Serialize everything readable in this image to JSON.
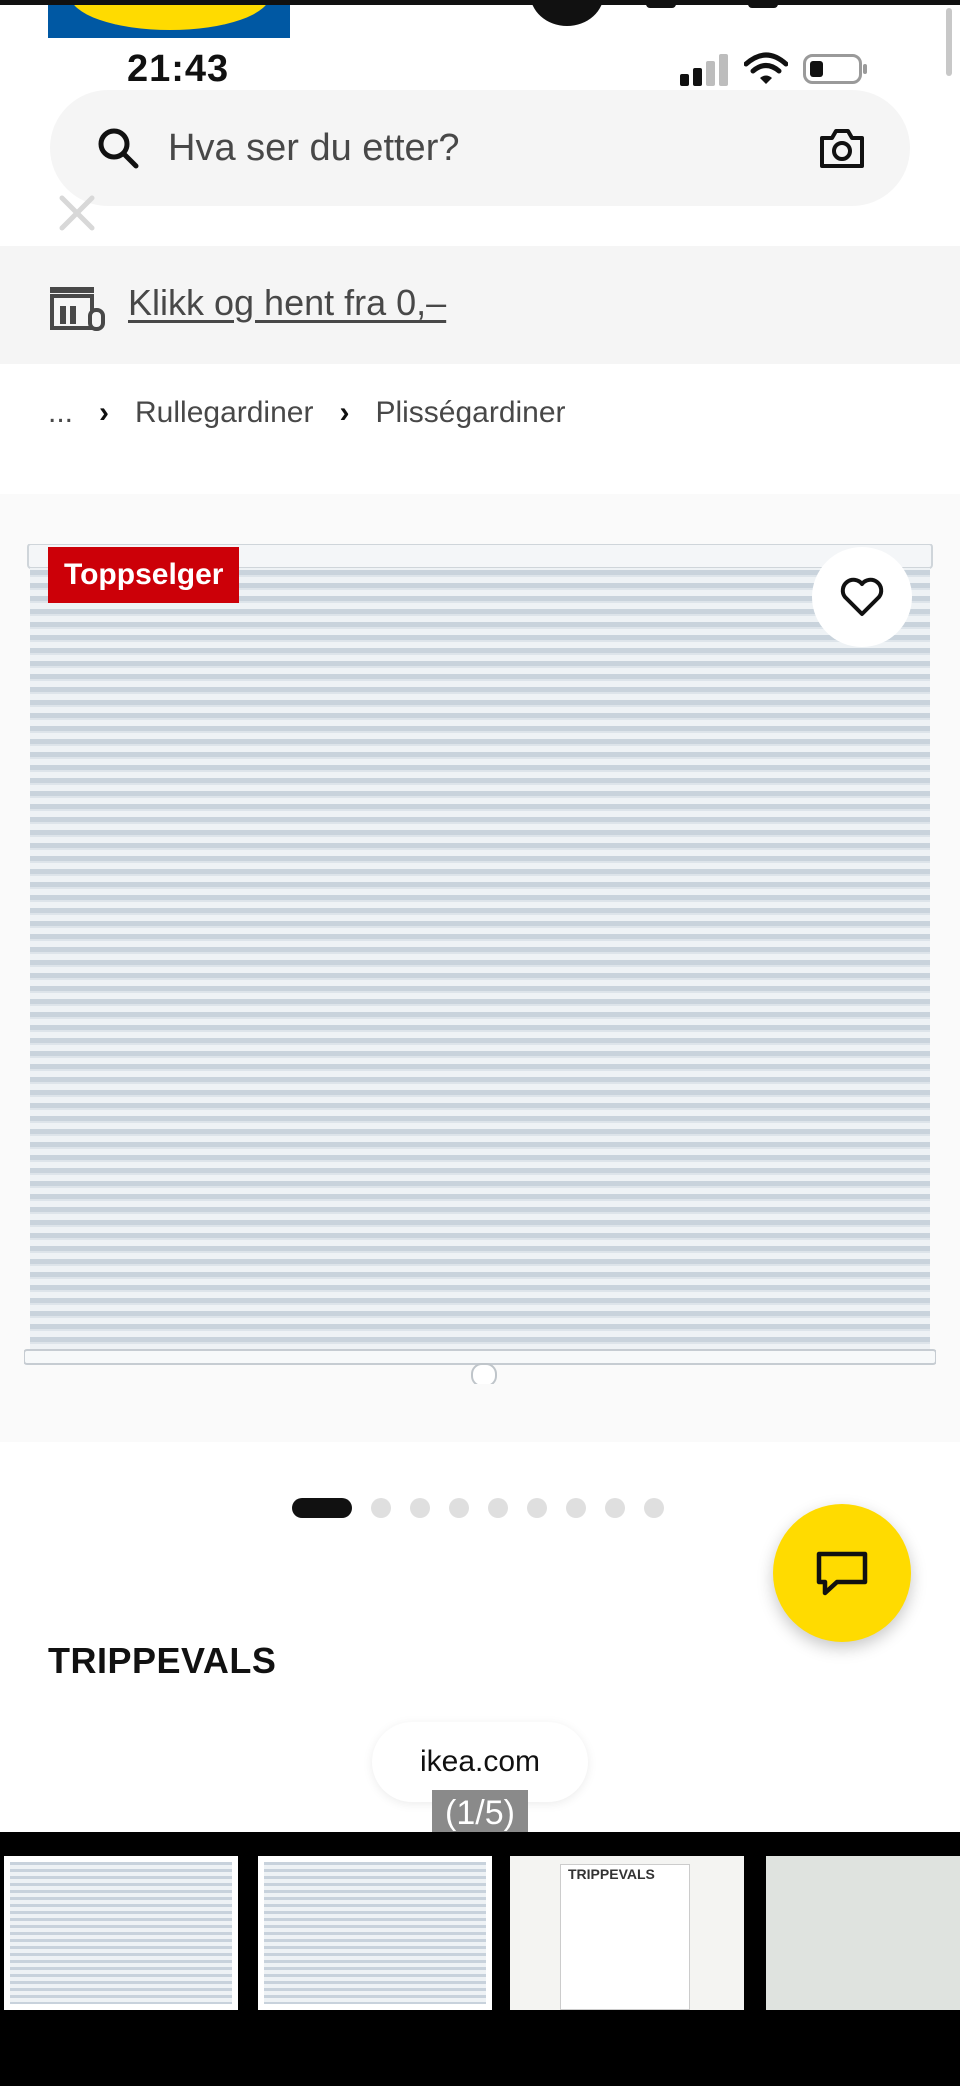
{
  "status_bar": {
    "time": "21:43"
  },
  "search": {
    "placeholder": "Hva ser du etter?"
  },
  "promo": {
    "link_text": "Klikk og hent fra 0,–"
  },
  "breadcrumb": {
    "ellipsis": "...",
    "items": [
      "Rullegardiner",
      "Plisségardiner"
    ]
  },
  "product": {
    "badge": "Toppselger",
    "name": "TRIPPEVALS"
  },
  "carousel": {
    "total_dots": 9,
    "active_index": 0
  },
  "browser": {
    "domain": "ikea.com"
  },
  "gallery": {
    "counter": "(1/5)",
    "thumb_box_label": "TRIPPEVALS"
  },
  "colors": {
    "ikea_blue": "#0058a3",
    "ikea_yellow": "#ffdb00",
    "badge_red": "#cc0008",
    "text_dark": "#111111",
    "text_muted": "#484848",
    "surface_grey": "#f5f5f5"
  },
  "icons": [
    "search-icon",
    "camera-icon",
    "close-icon",
    "store-icon",
    "chevron-right-icon",
    "heart-icon",
    "chat-icon",
    "signal-icon",
    "wifi-icon",
    "battery-icon"
  ]
}
